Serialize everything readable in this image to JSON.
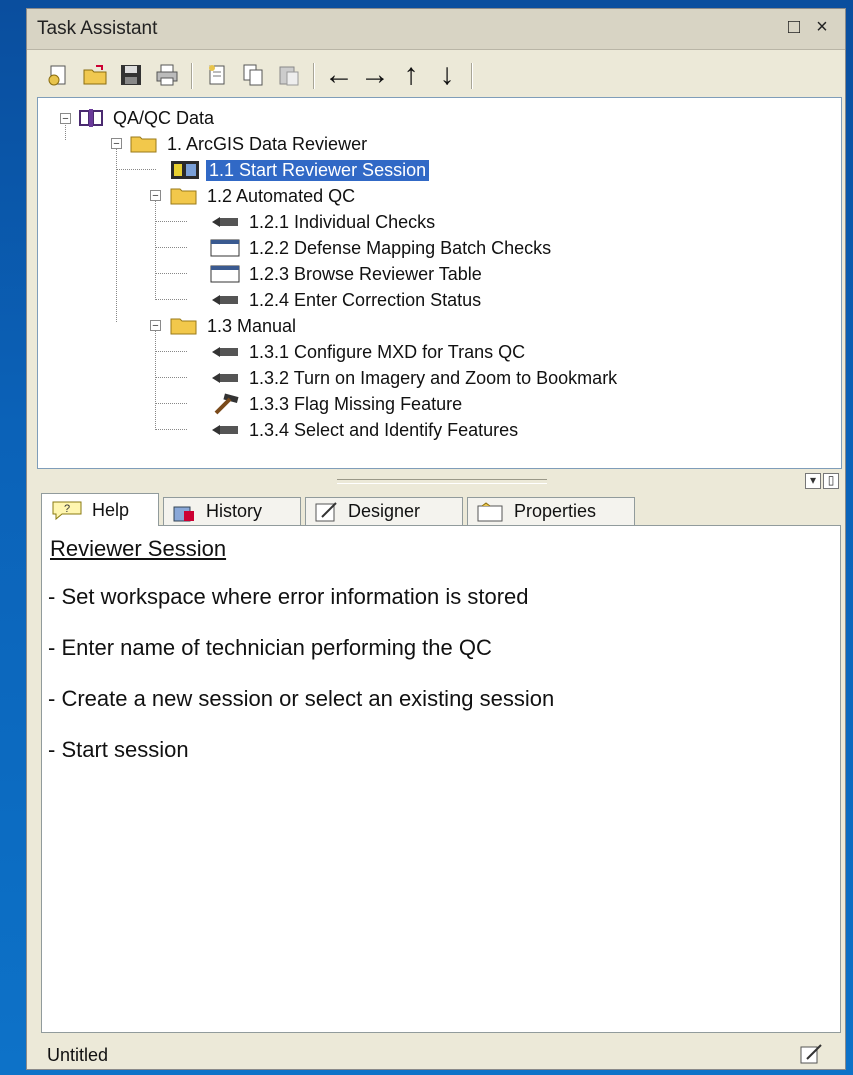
{
  "window": {
    "title": "Task Assistant",
    "restore_glyph": "□",
    "close_glyph": "×"
  },
  "toolbar": {
    "buttons": [
      {
        "name": "new-workflow-icon"
      },
      {
        "name": "open-folder-icon"
      },
      {
        "name": "save-icon"
      },
      {
        "name": "print-icon"
      },
      {
        "name": "new-step-icon"
      },
      {
        "name": "copy-icon"
      },
      {
        "name": "paste-icon"
      }
    ],
    "arrows": [
      "←",
      "→",
      "↑",
      "↓"
    ]
  },
  "tree": {
    "root": "QA/QC Data",
    "group1": "1. ArcGIS Data Reviewer",
    "item_1_1": "1.1 Start Reviewer Session",
    "group_1_2": "1.2 Automated QC",
    "item_1_2_1": "1.2.1 Individual Checks",
    "item_1_2_2": "1.2.2 Defense Mapping Batch Checks",
    "item_1_2_3": "1.2.3 Browse Reviewer Table",
    "item_1_2_4": "1.2.4 Enter Correction Status",
    "group_1_3": "1.3 Manual",
    "item_1_3_1": "1.3.1 Configure MXD  for Trans QC",
    "item_1_3_2": "1.3.2 Turn on Imagery and Zoom to Bookmark",
    "item_1_3_3": "1.3.3 Flag Missing Feature",
    "item_1_3_4": "1.3.4 Select and Identify Features",
    "selected": "1.1 Start Reviewer Session"
  },
  "tabs": {
    "help": "Help",
    "history": "History",
    "designer": "Designer",
    "properties": "Properties",
    "active": "Help"
  },
  "help": {
    "title": "Reviewer Session",
    "lines": [
      "- Set workspace where error information is stored",
      "- Enter name of technician performing the QC",
      "- Create a new session or select an existing session",
      "- Start session"
    ]
  },
  "status": {
    "text": "Untitled"
  },
  "colors": {
    "selection": "#3169c6",
    "background": "#0b62b8",
    "panel": "#ece9d8"
  }
}
